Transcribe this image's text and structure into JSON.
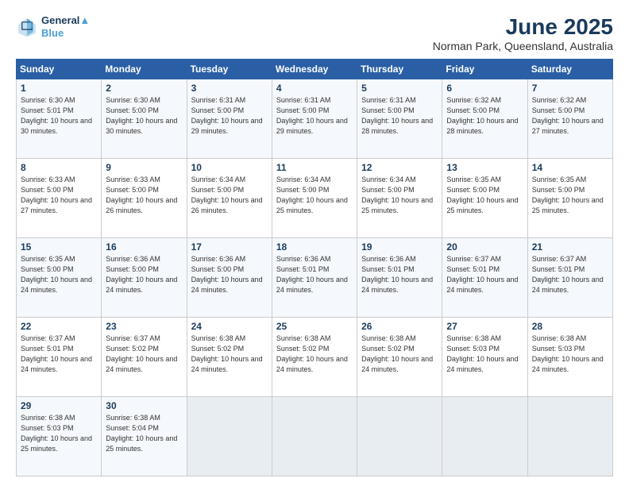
{
  "header": {
    "logo": {
      "line1": "General",
      "line2": "Blue"
    },
    "title": "June 2025",
    "location": "Norman Park, Queensland, Australia"
  },
  "calendar": {
    "headers": [
      "Sunday",
      "Monday",
      "Tuesday",
      "Wednesday",
      "Thursday",
      "Friday",
      "Saturday"
    ],
    "weeks": [
      [
        null,
        {
          "day": 2,
          "rise": "6:30 AM",
          "set": "5:00 PM",
          "daylight": "10 hours and 30 minutes."
        },
        {
          "day": 3,
          "rise": "6:31 AM",
          "set": "5:00 PM",
          "daylight": "10 hours and 29 minutes."
        },
        {
          "day": 4,
          "rise": "6:31 AM",
          "set": "5:00 PM",
          "daylight": "10 hours and 29 minutes."
        },
        {
          "day": 5,
          "rise": "6:31 AM",
          "set": "5:00 PM",
          "daylight": "10 hours and 28 minutes."
        },
        {
          "day": 6,
          "rise": "6:32 AM",
          "set": "5:00 PM",
          "daylight": "10 hours and 28 minutes."
        },
        {
          "day": 7,
          "rise": "6:32 AM",
          "set": "5:00 PM",
          "daylight": "10 hours and 27 minutes."
        }
      ],
      [
        {
          "day": 1,
          "rise": "6:30 AM",
          "set": "5:01 PM",
          "daylight": "10 hours and 30 minutes."
        },
        {
          "day": 8,
          "rise": "Sunrise: 6:33 AM",
          "set": "Sunset: 5:00 PM",
          "daylight": "10 hours and 27 minutes."
        },
        {
          "day": 9,
          "rise": "6:33 AM",
          "set": "5:00 PM",
          "daylight": "10 hours and 26 minutes."
        },
        {
          "day": 10,
          "rise": "6:34 AM",
          "set": "5:00 PM",
          "daylight": "10 hours and 26 minutes."
        },
        {
          "day": 11,
          "rise": "6:34 AM",
          "set": "5:00 PM",
          "daylight": "10 hours and 25 minutes."
        },
        {
          "day": 12,
          "rise": "6:34 AM",
          "set": "5:00 PM",
          "daylight": "10 hours and 25 minutes."
        },
        {
          "day": 13,
          "rise": "6:35 AM",
          "set": "5:00 PM",
          "daylight": "10 hours and 25 minutes."
        },
        {
          "day": 14,
          "rise": "6:35 AM",
          "set": "5:00 PM",
          "daylight": "10 hours and 25 minutes."
        }
      ],
      [
        {
          "day": 15,
          "rise": "6:35 AM",
          "set": "5:00 PM",
          "daylight": "10 hours and 24 minutes."
        },
        {
          "day": 16,
          "rise": "6:36 AM",
          "set": "5:00 PM",
          "daylight": "10 hours and 24 minutes."
        },
        {
          "day": 17,
          "rise": "6:36 AM",
          "set": "5:00 PM",
          "daylight": "10 hours and 24 minutes."
        },
        {
          "day": 18,
          "rise": "6:36 AM",
          "set": "5:01 PM",
          "daylight": "10 hours and 24 minutes."
        },
        {
          "day": 19,
          "rise": "6:36 AM",
          "set": "5:01 PM",
          "daylight": "10 hours and 24 minutes."
        },
        {
          "day": 20,
          "rise": "6:37 AM",
          "set": "5:01 PM",
          "daylight": "10 hours and 24 minutes."
        },
        {
          "day": 21,
          "rise": "6:37 AM",
          "set": "5:01 PM",
          "daylight": "10 hours and 24 minutes."
        }
      ],
      [
        {
          "day": 22,
          "rise": "6:37 AM",
          "set": "5:01 PM",
          "daylight": "10 hours and 24 minutes."
        },
        {
          "day": 23,
          "rise": "6:37 AM",
          "set": "5:02 PM",
          "daylight": "10 hours and 24 minutes."
        },
        {
          "day": 24,
          "rise": "6:38 AM",
          "set": "5:02 PM",
          "daylight": "10 hours and 24 minutes."
        },
        {
          "day": 25,
          "rise": "6:38 AM",
          "set": "5:02 PM",
          "daylight": "10 hours and 24 minutes."
        },
        {
          "day": 26,
          "rise": "6:38 AM",
          "set": "5:02 PM",
          "daylight": "10 hours and 24 minutes."
        },
        {
          "day": 27,
          "rise": "6:38 AM",
          "set": "5:03 PM",
          "daylight": "10 hours and 24 minutes."
        },
        {
          "day": 28,
          "rise": "6:38 AM",
          "set": "5:03 PM",
          "daylight": "10 hours and 24 minutes."
        }
      ],
      [
        {
          "day": 29,
          "rise": "6:38 AM",
          "set": "5:03 PM",
          "daylight": "10 hours and 25 minutes."
        },
        {
          "day": 30,
          "rise": "6:38 AM",
          "set": "5:04 PM",
          "daylight": "10 hours and 25 minutes."
        },
        null,
        null,
        null,
        null,
        null
      ]
    ]
  }
}
